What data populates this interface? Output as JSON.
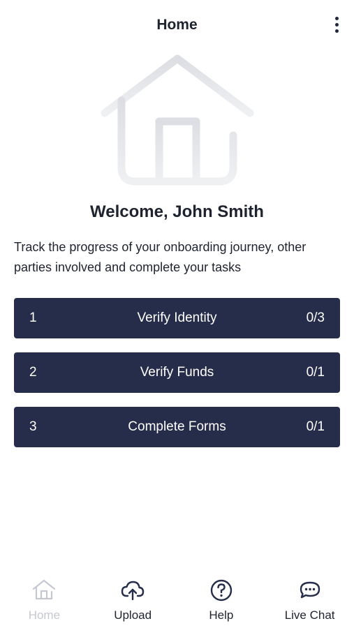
{
  "header": {
    "title": "Home",
    "menu_icon": "more-vertical-icon"
  },
  "hero": {
    "icon": "house-icon"
  },
  "welcome": {
    "title": "Welcome, John Smith",
    "description": "Track the progress of your onboarding journey, other parties involved and complete your tasks"
  },
  "tasks": [
    {
      "number": "1",
      "label": "Verify Identity",
      "progress": "0/3"
    },
    {
      "number": "2",
      "label": "Verify Funds",
      "progress": "0/1"
    },
    {
      "number": "3",
      "label": "Complete Forms",
      "progress": "0/1"
    }
  ],
  "bottom_nav": {
    "items": [
      {
        "label": "Home",
        "icon": "home-icon",
        "active": false
      },
      {
        "label": "Upload",
        "icon": "upload-icon",
        "active": true
      },
      {
        "label": "Help",
        "icon": "help-icon",
        "active": true
      },
      {
        "label": "Live Chat",
        "icon": "chat-icon",
        "active": true
      }
    ]
  },
  "colors": {
    "primary": "#262d4a",
    "text": "#1f2330",
    "muted": "#c5c8d0",
    "hero_stroke": "#e6e8ec"
  }
}
